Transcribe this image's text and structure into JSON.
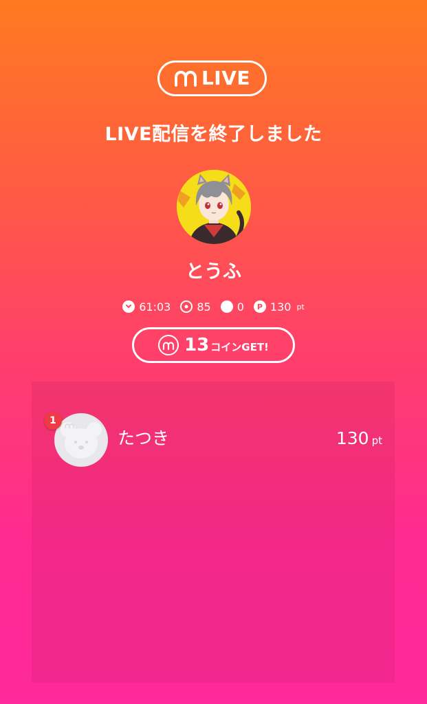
{
  "header": {
    "logo_icon": "m-logo-icon",
    "badge_text": "LIVE",
    "title": "LIVE配信を終了しました"
  },
  "streamer": {
    "avatar": "streamer-avatar",
    "name": "とうふ"
  },
  "stats": {
    "duration": "61:03",
    "viewers": "85",
    "comments": "0",
    "points": "130",
    "points_unit": "pt"
  },
  "coin": {
    "count": "13",
    "suffix": "コインGET!"
  },
  "ranking": [
    {
      "rank": "1",
      "name": "たつき",
      "score": "130",
      "unit": "pt"
    }
  ],
  "colors": {
    "gradient_top": "#ff7a1f",
    "gradient_bottom": "#ff2a9b",
    "rank_badge": "#ef3b45"
  }
}
